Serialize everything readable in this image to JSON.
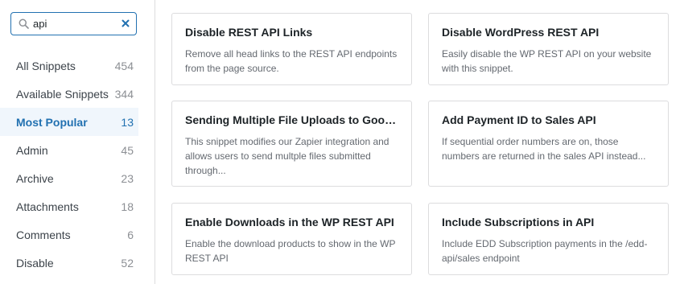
{
  "search": {
    "value": "api",
    "placeholder": "",
    "search_icon": "search-icon",
    "clear_icon": "close-icon"
  },
  "categories": [
    {
      "name": "All Snippets",
      "count": "454",
      "active": false
    },
    {
      "name": "Available Snippets",
      "count": "344",
      "active": false
    },
    {
      "name": "Most Popular",
      "count": "13",
      "active": true
    },
    {
      "name": "Admin",
      "count": "45",
      "active": false
    },
    {
      "name": "Archive",
      "count": "23",
      "active": false
    },
    {
      "name": "Attachments",
      "count": "18",
      "active": false
    },
    {
      "name": "Comments",
      "count": "6",
      "active": false
    },
    {
      "name": "Disable",
      "count": "52",
      "active": false
    }
  ],
  "cards": [
    {
      "title": "Disable REST API Links",
      "description": "Remove all head links to the REST API endpoints from the page source."
    },
    {
      "title": "Disable WordPress REST API",
      "description": "Easily disable the WP REST API on your website with this snippet."
    },
    {
      "title": "Sending Multiple File Uploads to Google ...",
      "description": "This snippet modifies our Zapier integration and allows users to send multple files submitted through..."
    },
    {
      "title": "Add Payment ID to Sales API",
      "description": "If sequential order numbers are on, those numbers are returned in the sales API instead..."
    },
    {
      "title": "Enable Downloads in the WP REST API",
      "description": "Enable the download products to show in the WP REST API"
    },
    {
      "title": "Include Subscriptions in API",
      "description": "Include EDD Subscription payments in the /edd-api/sales endpoint"
    }
  ],
  "colors": {
    "accent": "#2271b1",
    "active_bg": "#f0f6fc",
    "border": "#dcdcde"
  }
}
